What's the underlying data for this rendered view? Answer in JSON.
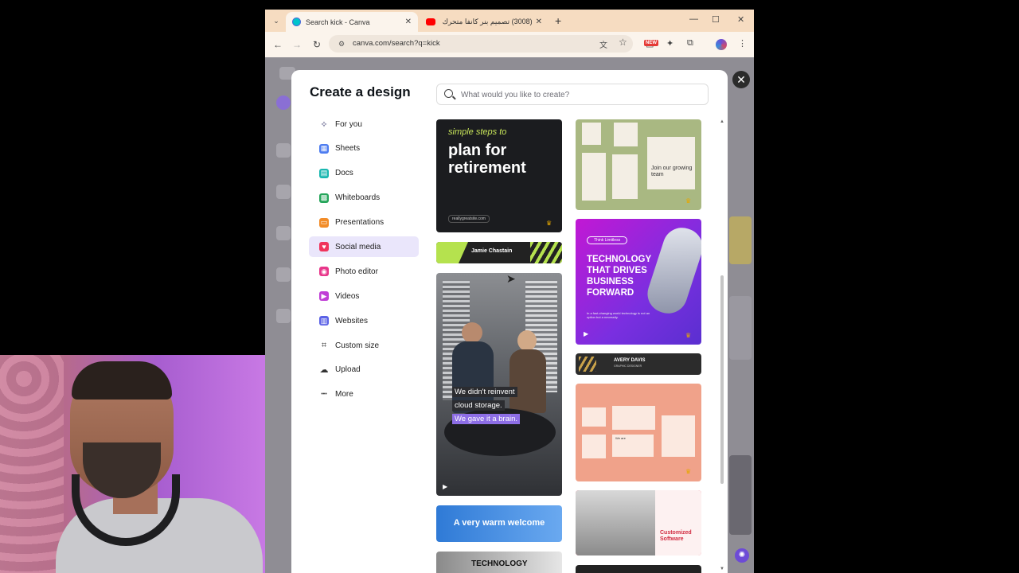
{
  "browser": {
    "tabs": [
      {
        "title": "Search kick - Canva",
        "active": true
      },
      {
        "title": "(3008) تصميم بنر كانفا متحرك - -",
        "active": false
      }
    ],
    "url": "canva.com/search?q=kick",
    "new_badge": "NEW"
  },
  "modal": {
    "title": "Create a design",
    "search_placeholder": "What would you like to create?",
    "nav": [
      {
        "label": "For you",
        "icon": "sparkle-icon",
        "color": "#4a4a7a"
      },
      {
        "label": "Sheets",
        "icon": "sheets-icon",
        "color": "#4d7cf0"
      },
      {
        "label": "Docs",
        "icon": "docs-icon",
        "color": "#19b7b0"
      },
      {
        "label": "Whiteboards",
        "icon": "whiteboard-icon",
        "color": "#25a55a"
      },
      {
        "label": "Presentations",
        "icon": "presentation-icon",
        "color": "#f28c28"
      },
      {
        "label": "Social media",
        "icon": "heart-icon",
        "color": "#f0345c",
        "active": true
      },
      {
        "label": "Photo editor",
        "icon": "camera-icon",
        "color": "#e8368a"
      },
      {
        "label": "Videos",
        "icon": "video-icon",
        "color": "#c03ed6"
      },
      {
        "label": "Websites",
        "icon": "website-icon",
        "color": "#5b62e6"
      },
      {
        "label": "Custom size",
        "icon": "crop-icon",
        "color": "#333333"
      },
      {
        "label": "Upload",
        "icon": "cloud-upload-icon",
        "color": "#333333"
      },
      {
        "label": "More",
        "icon": "more-dots-icon",
        "color": "#333333"
      }
    ]
  },
  "templates": {
    "retirement": {
      "line1": "simple steps to",
      "line2": "plan for",
      "line3": "retirement",
      "footer": "reallygreatsite.com"
    },
    "hiring": {
      "headline": "Join our growing team"
    },
    "banner_jamie": {
      "name": "Jamie Chastain"
    },
    "technology": {
      "tag": "Think Limitless",
      "headline": "TECHNOLOGY THAT DRIVES BUSINESS FORWARD",
      "sub": "In a fast-changing world technology is not an option but a necessity."
    },
    "avery": {
      "name": "AVERY DAVIS",
      "role": "GRAPHIC DESIGNER"
    },
    "office": {
      "l1": "We didn't reinvent",
      "l2": "cloud storage.",
      "l3": "We gave it a brain."
    },
    "peach": {
      "small": "We are"
    },
    "welcome": {
      "text": "A very warm welcome"
    },
    "customized": {
      "text": "Customized Software"
    },
    "tech_bottom": {
      "text": "TECHNOLOGY"
    }
  }
}
